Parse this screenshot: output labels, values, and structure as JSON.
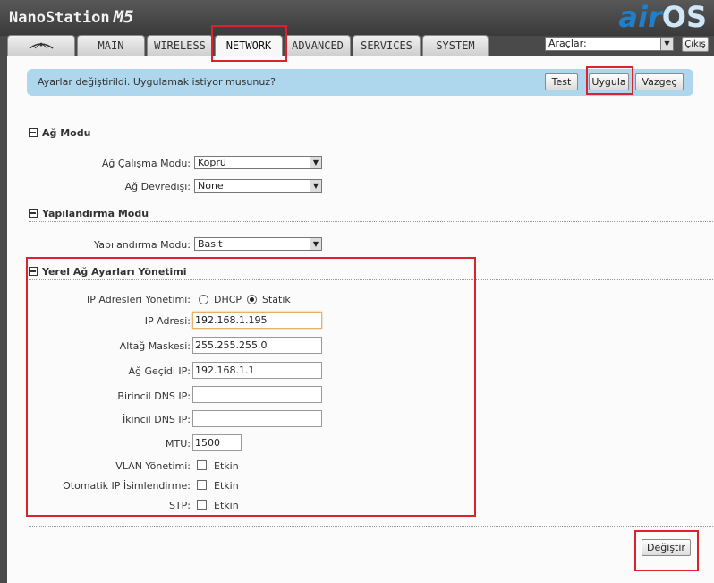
{
  "header": {
    "brand": "NanoStation",
    "model": "M5",
    "logo_air": "air",
    "logo_os": "OS"
  },
  "tabs": [
    {
      "label": ""
    },
    {
      "label": "MAIN"
    },
    {
      "label": "WIRELESS"
    },
    {
      "label": "NETWORK",
      "active": true
    },
    {
      "label": "ADVANCED"
    },
    {
      "label": "SERVICES"
    },
    {
      "label": "SYSTEM"
    }
  ],
  "tools": {
    "selected": "Araçlar:",
    "logout_label": "Çıkış"
  },
  "notice": {
    "text": "Ayarlar değiştirildi. Uygulamak istiyor musunuz?",
    "test_label": "Test",
    "apply_label": "Uygula",
    "cancel_label": "Vazgeç"
  },
  "network_mode": {
    "title": "Ağ Modu",
    "mode_label": "Ağ Çalışma Modu:",
    "mode_value": "Köprü",
    "disable_label": "Ağ Devredışı:",
    "disable_value": "None"
  },
  "config_mode": {
    "title": "Yapılandırma Modu",
    "label": "Yapılandırma Modu:",
    "value": "Basit"
  },
  "lan": {
    "title": "Yerel Ağ Ayarları Yönetimi",
    "ip_mode_label": "IP Adresleri Yönetimi:",
    "dhcp_label": "DHCP",
    "static_label": "Statik",
    "ip_label": "IP Adresi:",
    "ip_value": "192.168.1.195",
    "mask_label": "Altağ Maskesi:",
    "mask_value": "255.255.255.0",
    "gateway_label": "Ağ Geçidi IP:",
    "gateway_value": "192.168.1.1",
    "dns1_label": "Birincil DNS IP:",
    "dns1_value": "",
    "dns2_label": "İkincil DNS IP:",
    "dns2_value": "",
    "mtu_label": "MTU:",
    "mtu_value": "1500",
    "vlan_label": "VLAN Yönetimi:",
    "alias_label": "Otomatik IP İsimlendirme:",
    "stp_label": "STP:",
    "enable_label": "Etkin"
  },
  "change_label": "Değiştir",
  "colors": {
    "highlight": "#d9232e",
    "notice_bg": "#aed6ec",
    "logo": "#1f7fc8"
  }
}
